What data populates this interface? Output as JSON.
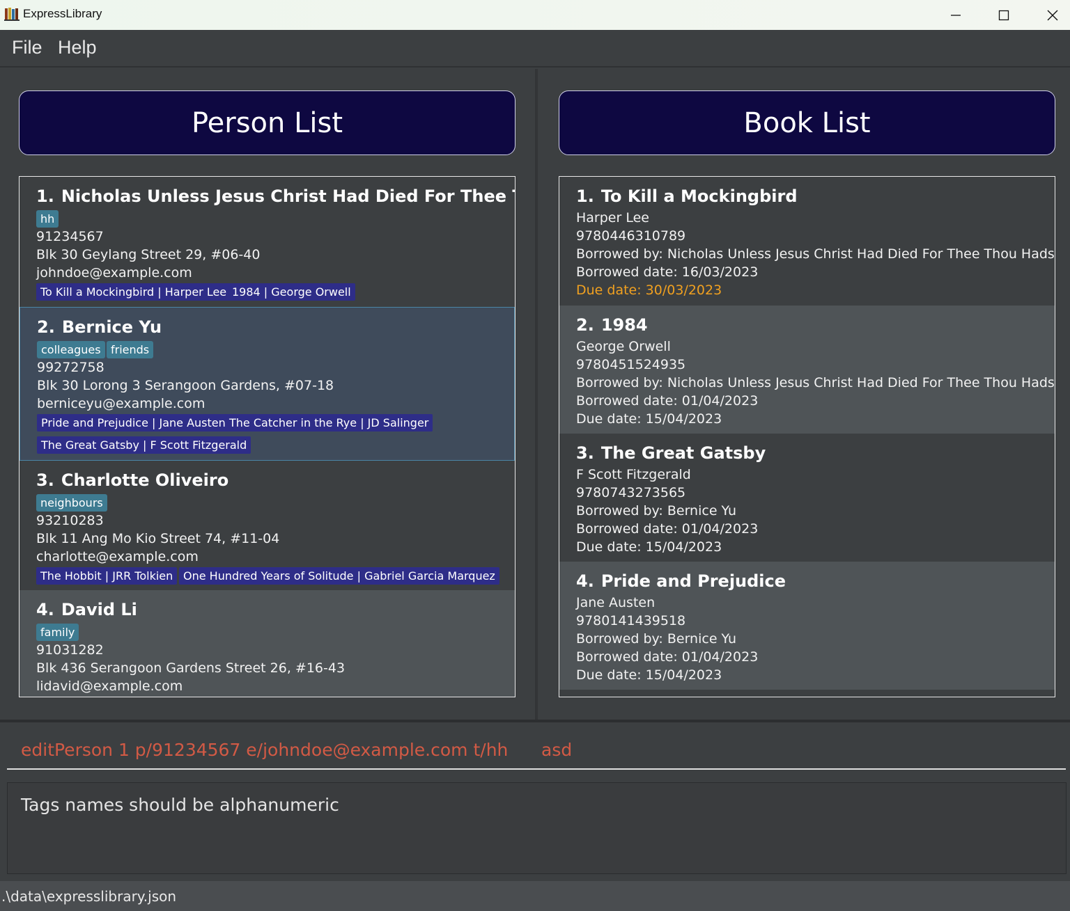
{
  "window": {
    "title": "ExpressLibrary"
  },
  "menu": {
    "file": "File",
    "help": "Help"
  },
  "person_panel": {
    "header": "Person List",
    "persons": [
      {
        "index": "1.",
        "name": "Nicholas Unless Jesus Christ Had Died For Thee Thou Had...",
        "tags": [
          "hh"
        ],
        "phone": "91234567",
        "address": "Blk 30 Geylang Street 29, #06-40",
        "email": "johndoe@example.com",
        "books": [
          "To Kill a Mockingbird | Harper Lee",
          "1984 | George Orwell"
        ]
      },
      {
        "index": "2.",
        "name": "Bernice Yu",
        "tags": [
          "colleagues",
          "friends"
        ],
        "phone": "99272758",
        "address": "Blk 30 Lorong 3 Serangoon Gardens, #07-18",
        "email": "berniceyu@example.com",
        "books": [
          "Pride and Prejudice | Jane Austen",
          "The Catcher in the Rye | JD Salinger",
          "The Great Gatsby | F Scott Fitzgerald"
        ]
      },
      {
        "index": "3.",
        "name": "Charlotte Oliveiro",
        "tags": [
          "neighbours"
        ],
        "phone": "93210283",
        "address": "Blk 11 Ang Mo Kio Street 74, #11-04",
        "email": "charlotte@example.com",
        "books": [
          "The Hobbit | JRR Tolkien",
          "One Hundred Years of Solitude | Gabriel Garcia Marquez"
        ]
      },
      {
        "index": "4.",
        "name": "David Li",
        "tags": [
          "family"
        ],
        "phone": "91031282",
        "address": "Blk 436 Serangoon Gardens Street 26, #16-43",
        "email": "lidavid@example.com"
      }
    ]
  },
  "book_panel": {
    "header": "Book List",
    "books": [
      {
        "index": "1.",
        "title": "To Kill a Mockingbird",
        "author": "Harper Lee",
        "isbn": "9780446310789",
        "borrowed_by": "Borrowed by: Nicholas Unless Jesus Christ Had Died For Thee Thou Hadst Be...",
        "borrowed_date": "Borrowed date: 16/03/2023",
        "due_date": "Due date: 30/03/2023"
      },
      {
        "index": "2.",
        "title": "1984",
        "author": "George Orwell",
        "isbn": "9780451524935",
        "borrowed_by": "Borrowed by: Nicholas Unless Jesus Christ Had Died For Thee Thou Hadst Be...",
        "borrowed_date": "Borrowed date: 01/04/2023",
        "due_date": "Due date: 15/04/2023"
      },
      {
        "index": "3.",
        "title": "The Great Gatsby",
        "author": "F Scott Fitzgerald",
        "isbn": "9780743273565",
        "borrowed_by": "Borrowed by: Bernice Yu",
        "borrowed_date": "Borrowed date: 01/04/2023",
        "due_date": "Due date: 15/04/2023"
      },
      {
        "index": "4.",
        "title": "Pride and Prejudice",
        "author": "Jane Austen",
        "isbn": "9780141439518",
        "borrowed_by": "Borrowed by: Bernice Yu",
        "borrowed_date": "Borrowed date: 01/04/2023",
        "due_date": "Due date: 15/04/2023"
      }
    ]
  },
  "command": {
    "value": "editPerson 1 p/91234567 e/johndoe@example.com t/hh      asd"
  },
  "result": {
    "text": "Tags names should be alphanumeric"
  },
  "status": {
    "path": ".\\data\\expresslibrary.json"
  },
  "colors": {
    "header_bg": "#0e0841",
    "tag_bg": "#3e7b91",
    "book_tag_bg": "#2e2d88",
    "command_error": "#d25a45",
    "due_warning": "#f0a020"
  }
}
